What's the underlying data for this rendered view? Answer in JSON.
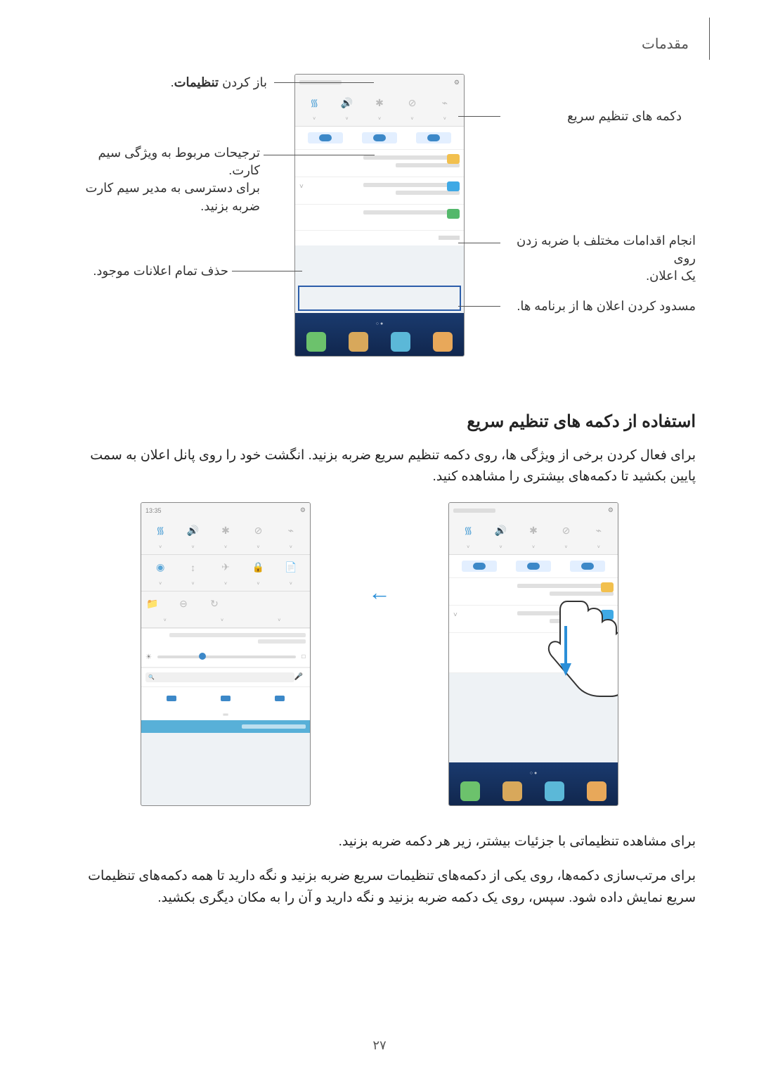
{
  "header": "مقدمات",
  "callouts": {
    "open_settings_prefix": "باز کردن ",
    "open_settings_bold": "تنظیمات",
    "open_settings_suffix": ".",
    "quick_settings_buttons": "دکمه های تنظیم سریع",
    "sim_prefs_line1": "ترجیحات مربوط به ویژگی سیم کارت.",
    "sim_prefs_line2": "برای دسترسی به مدیر سیم کارت ضربه بزنید.",
    "tap_notification_line1": "انجام اقدامات مختلف با ضربه زدن روی",
    "tap_notification_line2": "یک اعلان.",
    "clear_all": "حذف تمام اعلانات موجود.",
    "block_notifications": "مسدود کردن اعلان ها از برنامه ها."
  },
  "section_heading": "استفاده از دکمه های تنظیم سریع",
  "para1": "برای فعال کردن برخی از ویژگی ها، روی دکمه تنظیم سریع ضربه بزنید. انگشت خود را روی پانل اعلان به سمت پایین بکشید تا دکمه‌های بیشتری را مشاهده کنید.",
  "para2": "برای مشاهده تنظیماتی با جزئیات بیشتر، زیر هر دکمه ضربه بزنید.",
  "para3": "برای مرتب‌سازی دکمه‌ها، روی یکی از دکمه‌های تنظیمات سریع ضربه بزنید و نگه دارید تا همه دکمه‌های تنظیمات سریع نمایش داده شود. سپس، روی یک دکمه ضربه بزنید و نگه دارید و آن را به مکان دیگری بکشید.",
  "phone": {
    "time": "13:35",
    "gear": "⚙"
  },
  "qs_icons": {
    "wifi": "᯾",
    "sound": "🔊",
    "bluetooth": "✱",
    "dnd": "⊘",
    "flashlight": "⌁",
    "location": "◉",
    "sync": "↕",
    "airplane": "✈",
    "rotate": "🔒",
    "hotspot": "📄",
    "refresh": "↻",
    "minus": "⊖",
    "folder": "📁"
  },
  "arrow_glyph": "←",
  "page_number": "٢٧"
}
